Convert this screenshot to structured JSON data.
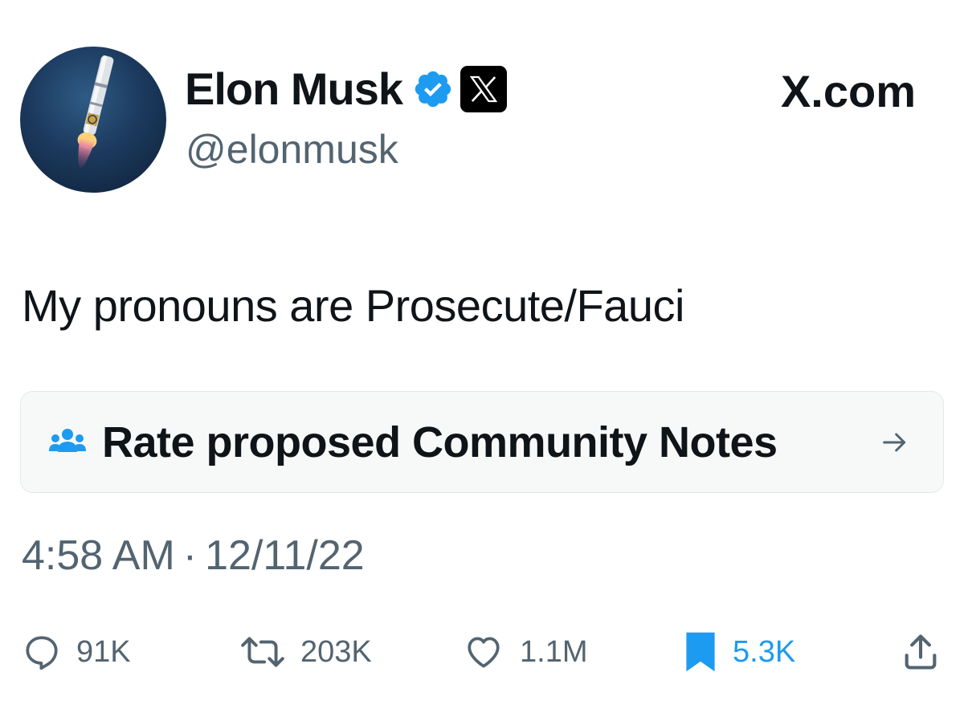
{
  "user": {
    "display_name": "Elon Musk",
    "handle": "@elonmusk",
    "verified_icon": "verified-badge-icon",
    "affiliate_icon": "x-logo-icon"
  },
  "brand": {
    "site": "X.com"
  },
  "tweet": {
    "text": "My pronouns are Prosecute/Fauci"
  },
  "community_notes": {
    "label": "Rate proposed Community Notes",
    "icon": "community-icon",
    "arrow_icon": "arrow-right-icon"
  },
  "meta": {
    "time": "4:58 AM",
    "separator": "·",
    "date": "12/11/22"
  },
  "actions": {
    "replies": "91K",
    "reposts": "203K",
    "likes": "1.1M",
    "bookmarks": "5.3K"
  },
  "colors": {
    "accent": "#1d9bf0",
    "text": "#0f1419",
    "secondary": "#536471",
    "card_bg": "#f7f9f9"
  }
}
